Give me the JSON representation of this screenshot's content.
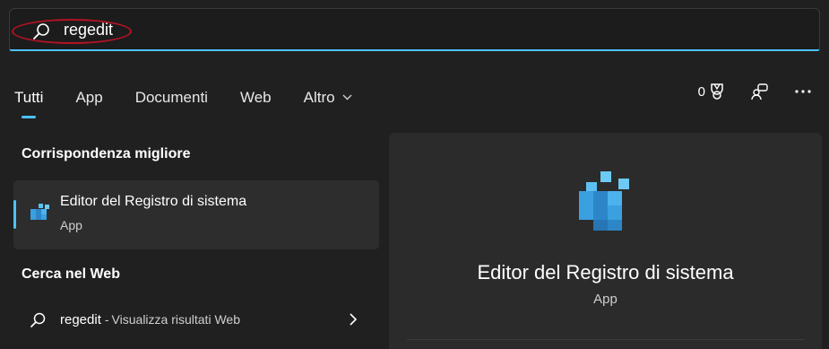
{
  "search": {
    "query": "regedit",
    "icon": "search-icon"
  },
  "tabs": [
    {
      "label": "Tutti",
      "active": true
    },
    {
      "label": "App"
    },
    {
      "label": "Documenti"
    },
    {
      "label": "Web"
    },
    {
      "label": "Altro",
      "icon": "chevron-down-icon"
    }
  ],
  "toolbar": {
    "points": "0",
    "icons": [
      "trophy-icon",
      "share-devices-icon",
      "more-options-icon"
    ]
  },
  "best_match": {
    "section_title": "Corrispondenza migliore",
    "name": "Editor del Registro di sistema",
    "type": "App",
    "icon": "registry-editor-icon"
  },
  "web_search": {
    "section_title": "Cerca nel Web",
    "query": "regedit",
    "separator": "-",
    "subtitle": "Visualizza risultati Web",
    "icon": "search-icon"
  },
  "preview": {
    "title": "Editor del Registro di sistema",
    "type": "App",
    "icon": "registry-editor-icon"
  },
  "colors": {
    "background": "#202020",
    "accent": "#4cc2ff",
    "highlight": "#b01424",
    "card": "#2d2d2d"
  }
}
